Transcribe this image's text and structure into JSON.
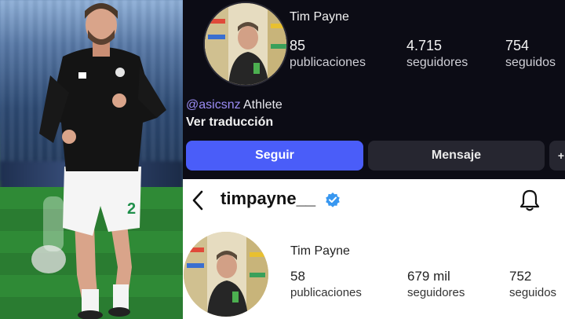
{
  "colors": {
    "dark_bg": "#0c0c15",
    "follow_button": "#4a5df9",
    "message_button": "#262630",
    "mention": "#9b8cf5",
    "verified": "#3897f0",
    "light_bg": "#ffffff"
  },
  "dark_profile": {
    "name": "Tim Payne",
    "stats": [
      {
        "value": "85",
        "label": "publicaciones"
      },
      {
        "value": "4.715",
        "label": "seguidores"
      },
      {
        "value": "754",
        "label": "seguidos"
      }
    ],
    "bio_handle": "@asicsnz",
    "bio_role": "Athlete",
    "translate_label": "Ver traducción",
    "follow_label": "Seguir",
    "message_label": "Mensaje",
    "more_icon": "+"
  },
  "light_profile": {
    "username": "timpayne__",
    "name": "Tim Payne",
    "stats": [
      {
        "value": "58",
        "label": "publicaciones"
      },
      {
        "value": "679 mil",
        "label": "seguidores"
      },
      {
        "value": "752",
        "label": "seguidos"
      }
    ],
    "icons": {
      "back": "chevron-left-icon",
      "verified": "verified-badge-icon",
      "notifications": "bell-icon"
    }
  }
}
